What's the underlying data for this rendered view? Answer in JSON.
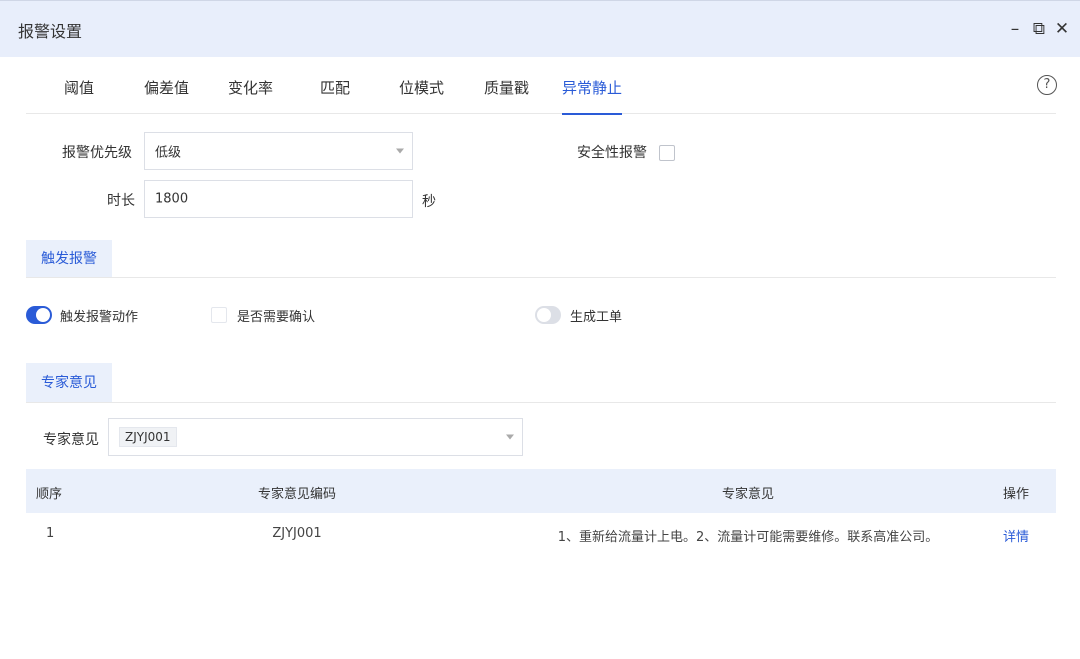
{
  "window": {
    "title": "报警设置",
    "controls": {
      "minimize": "–",
      "maximize": "⧉",
      "close": "✕"
    }
  },
  "tabs": [
    {
      "label": "阈值",
      "active": false
    },
    {
      "label": "偏差值",
      "active": false
    },
    {
      "label": "变化率",
      "active": false
    },
    {
      "label": "匹配",
      "active": false
    },
    {
      "label": "位模式",
      "active": false
    },
    {
      "label": "质量戳",
      "active": false
    },
    {
      "label": "异常静止",
      "active": true
    }
  ],
  "help": "?",
  "form": {
    "priority_label": "报警优先级",
    "priority_value": "低级",
    "duration_label": "时长",
    "duration_value": "1800",
    "duration_unit": "秒",
    "safety_label": "安全性报警",
    "safety_checked": false
  },
  "trigger_section": {
    "title": "触发报警",
    "trigger_action": {
      "label": "触发报警动作",
      "on": true
    },
    "need_confirm": {
      "label": "是否需要确认",
      "checked": false
    },
    "work_order": {
      "label": "生成工单",
      "on": false
    }
  },
  "expert_section": {
    "title": "专家意见",
    "select_label": "专家意见",
    "selected_tag": "ZJYJ001"
  },
  "table": {
    "headers": [
      "顺序",
      "专家意见编码",
      "专家意见",
      "操作"
    ],
    "rows": [
      {
        "order": "1",
        "code": "ZJYJ001",
        "opinion": "1、重新给流量计上电。2、流量计可能需要维修。联系高准公司。",
        "action": "详情"
      }
    ]
  },
  "colors": {
    "accent": "#2a5bd7",
    "titlebar": "#e8eefb",
    "section_bg": "#eaf0fb"
  }
}
